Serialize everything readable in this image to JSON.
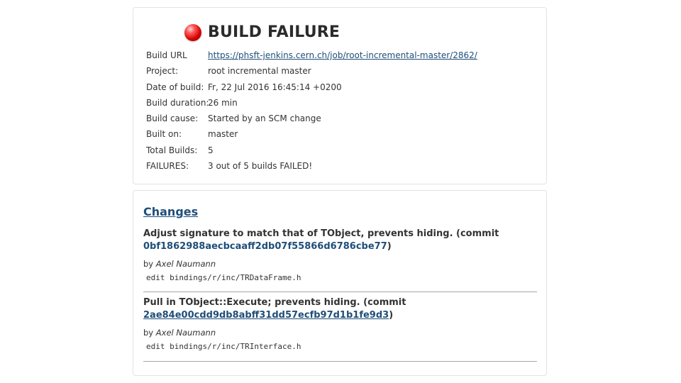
{
  "build": {
    "status_icon": "red-ball-icon",
    "status_color": "#d40000",
    "title": "BUILD FAILURE",
    "fields": [
      {
        "label": "Build URL",
        "value": "https://phsft-jenkins.cern.ch/job/root-incremental-master/2862/"
      },
      {
        "label": "Project:",
        "value": "root incremental master"
      },
      {
        "label": "Date of build:",
        "value": "Fr, 22 Jul 2016 16:45:14 +0200"
      },
      {
        "label": "Build duration:",
        "value": "26 min"
      },
      {
        "label": "Build cause:",
        "value": "Started by an SCM change"
      },
      {
        "label": "Built on:",
        "value": "master"
      },
      {
        "label": "Total Builds:",
        "value": "5"
      },
      {
        "label": "FAILURES:",
        "value": "3 out of 5 builds FAILED!"
      }
    ]
  },
  "changes": {
    "heading": "Changes",
    "items": [
      {
        "title": "Adjust signature to match that of TObject, prevents hiding. (commit ",
        "hash": "0bf1862988aecbcaaff2db07f55866d6786cbe77",
        "close": ")",
        "by": "by ",
        "author": "Axel Naumann",
        "file": "edit bindings/r/inc/TRDataFrame.h"
      },
      {
        "title": "Pull in TObject::Execute; prevents hiding. (commit ",
        "hash": "2ae84e00cdd9db8abff31dd57ecfb97d1b1fe9d3",
        "close": ")",
        "by": "by ",
        "author": "Axel Naumann",
        "file": "edit bindings/r/inc/TRInterface.h"
      }
    ]
  },
  "colors": {
    "link": "#1f4e79",
    "text": "#333333",
    "border": "#e3e3e3"
  }
}
